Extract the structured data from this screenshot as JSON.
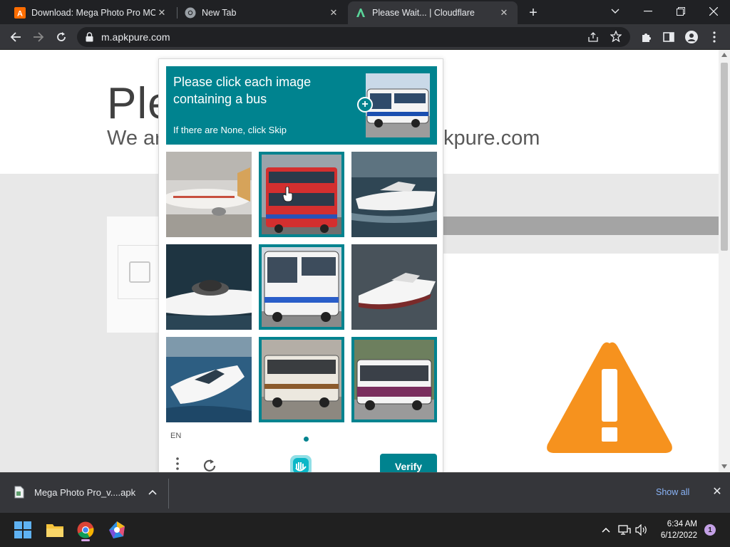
{
  "browser": {
    "tabs": [
      {
        "title": "Download: Mega Photo Pro MOD",
        "favicon": "apkpure-icon"
      },
      {
        "title": "New Tab",
        "favicon": "chrome-icon"
      },
      {
        "title": "Please Wait... | Cloudflare",
        "favicon": "cloudflare-icon",
        "active": true
      }
    ],
    "url": "m.apkpure.com"
  },
  "page": {
    "title_fragment": "Ple",
    "subtitle_left": "We ar",
    "subtitle_right": "kpure.com"
  },
  "captcha": {
    "prompt": "Please click each image containing a bus",
    "skip_hint": "If there are None, click Skip",
    "language": "EN",
    "verify_label": "Verify",
    "accent_color": "#00838f",
    "tiles": [
      {
        "subject": "airplane",
        "selected": false
      },
      {
        "subject": "double-decker bus",
        "selected": true
      },
      {
        "subject": "speedboat",
        "selected": false
      },
      {
        "subject": "speedboat",
        "selected": false
      },
      {
        "subject": "bus",
        "selected": true
      },
      {
        "subject": "speedboat",
        "selected": false
      },
      {
        "subject": "speedboat",
        "selected": false
      },
      {
        "subject": "bus",
        "selected": true
      },
      {
        "subject": "bus",
        "selected": true
      }
    ]
  },
  "downloads": {
    "file_name": "Mega Photo Pro_v....apk",
    "show_all_label": "Show all"
  },
  "taskbar": {
    "time": "6:34 AM",
    "date": "6/12/2022",
    "notification_count": "1"
  }
}
